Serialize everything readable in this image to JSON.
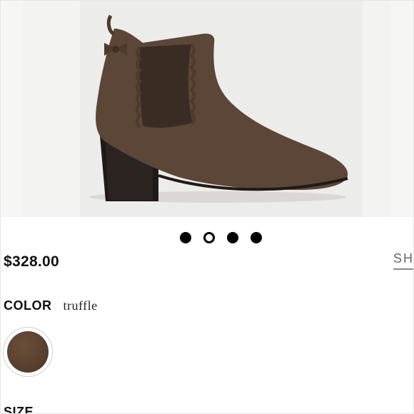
{
  "product": {
    "price": "$328.00",
    "share_label": "SHA",
    "image": {
      "icon": "ankle-boot-image",
      "color_main": "#5b4637",
      "color_heel": "#1f1a17",
      "color_elastic": "#3a2c22"
    },
    "gallery": {
      "dot_count": 4,
      "active_index": 1
    }
  },
  "color": {
    "label": "COLOR",
    "value": "truffle",
    "swatch_color": "#5a4130"
  },
  "size": {
    "label": "SIZE"
  }
}
